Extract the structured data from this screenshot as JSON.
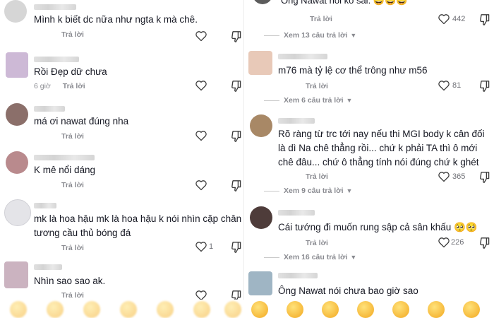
{
  "left": [
    {
      "text": "Mình k biết dc nữa như ngta k mà chê.",
      "meta_age": "",
      "reply": "Trả lời",
      "likes": ""
    },
    {
      "text": "Rồi Đẹp dữ chưa",
      "meta_age": "6 giờ",
      "reply": "Trả lời",
      "likes": ""
    },
    {
      "text": "má ơi nawat đúng nha",
      "meta_age": "",
      "reply": "Trả lời",
      "likes": ""
    },
    {
      "text": "K mê nổi dáng",
      "meta_age": "",
      "reply": "Trả lời",
      "likes": ""
    },
    {
      "text_lines": [
        "mk là hoa hậu mk là hoa hậu k nói nhìn cặp chân",
        "tương cầu thủ bóng đá"
      ],
      "meta_age": "",
      "reply": "Trả lời",
      "likes": "1"
    },
    {
      "text": "Nhìn sao sao ak.",
      "meta_age": "",
      "reply": "Trả lời",
      "likes": ""
    }
  ],
  "right": {
    "top_partial": {
      "text": "Ông Nawat nói ko sai. 😄😄😄",
      "reply": "Trả lời",
      "likes": "442"
    },
    "comments": [
      {
        "view_replies": "Xem 13 câu trả lời",
        "text": "m76 mà tỷ lệ cơ thể trông như m56",
        "reply": "Trả lời",
        "likes": "81"
      },
      {
        "view_replies": "Xem 6 câu trả lời",
        "text_lines": [
          "Rõ ràng từ trc tới nay nếu thi MGI body k cân đối",
          "là dì Na chê thẳng rồi... chứ k phải TA thì ô mới",
          "chê đâu... chứ ô thẳng tính nói đúng chứ k ghét"
        ],
        "reply": "Trả lời",
        "likes": "365"
      },
      {
        "view_replies": "Xem 9 câu trả lời",
        "text": "Cái tướng đi muốn rung sập cả sân khấu 🥺🥺",
        "reply": "Trả lời",
        "likes": "226"
      },
      {
        "view_replies": "Xem 16 câu trả lời",
        "text": "Ông Nawat nói chưa bao giờ sao",
        "reply": "",
        "likes": ""
      }
    ]
  },
  "icons": {
    "like": "heart-outline-icon",
    "dislike": "thumbs-down-icon",
    "chevron": "chevron-down-icon"
  },
  "colors": {
    "text": "#161823",
    "muted": "#8a8b91"
  }
}
